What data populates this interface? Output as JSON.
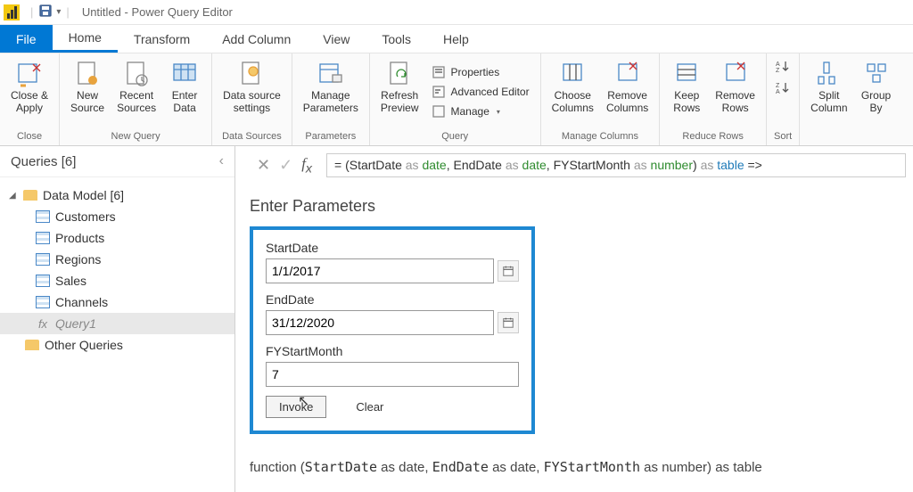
{
  "titlebar": {
    "title": "Untitled - Power Query Editor"
  },
  "tabs": {
    "file": "File",
    "home": "Home",
    "transform": "Transform",
    "add_column": "Add Column",
    "view": "View",
    "tools": "Tools",
    "help": "Help"
  },
  "ribbon": {
    "close": {
      "close_apply": "Close &\nApply",
      "group": "Close"
    },
    "new_query": {
      "new_source": "New\nSource",
      "recent_sources": "Recent\nSources",
      "enter_data": "Enter\nData",
      "group": "New Query"
    },
    "data_sources": {
      "settings": "Data source\nsettings",
      "group": "Data Sources"
    },
    "parameters": {
      "manage": "Manage\nParameters",
      "group": "Parameters"
    },
    "query": {
      "refresh": "Refresh\nPreview",
      "properties": "Properties",
      "advanced": "Advanced Editor",
      "manage": "Manage",
      "group": "Query"
    },
    "manage_columns": {
      "choose": "Choose\nColumns",
      "remove": "Remove\nColumns",
      "group": "Manage Columns"
    },
    "reduce_rows": {
      "keep": "Keep\nRows",
      "remove": "Remove\nRows",
      "group": "Reduce Rows"
    },
    "sort": {
      "group": "Sort"
    },
    "transform": {
      "split": "Split\nColumn",
      "group_by": "Group\nBy"
    }
  },
  "queries": {
    "header": "Queries [6]",
    "folder": "Data Model [6]",
    "items": [
      "Customers",
      "Products",
      "Regions",
      "Sales",
      "Channels"
    ],
    "fx_item": "Query1",
    "other": "Other Queries"
  },
  "formula": {
    "prefix": "= (StartDate ",
    "as1": "as ",
    "t1": "date",
    "c1": ", EndDate ",
    "as2": "as ",
    "t2": "date",
    "c2": ", FYStartMonth ",
    "as3": "as ",
    "t3": "number",
    "close": ") ",
    "as4": "as ",
    "ret": "table",
    "arrow": " =>"
  },
  "params": {
    "title": "Enter Parameters",
    "p1_label": "StartDate",
    "p1_value": "1/1/2017",
    "p2_label": "EndDate",
    "p2_value": "31/12/2020",
    "p3_label": "FYStartMonth",
    "p3_value": "7",
    "invoke": "Invoke",
    "clear": "Clear"
  },
  "signature": {
    "pre": "function (",
    "sd": "StartDate",
    "a1": " as date, ",
    "ed": "EndDate",
    "a2": " as date, ",
    "fy": "FYStartMonth",
    "a3": " as number) as table"
  }
}
